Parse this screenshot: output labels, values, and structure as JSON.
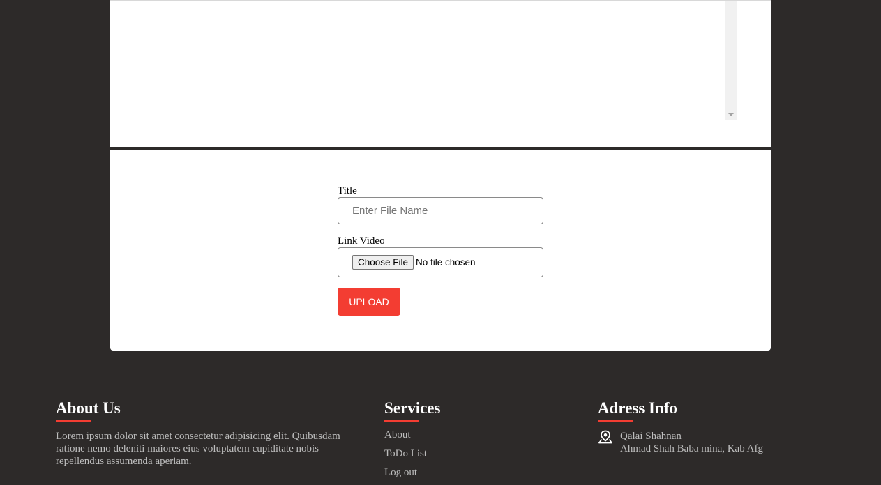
{
  "form": {
    "title_label": "Title",
    "title_placeholder": "Enter File Name",
    "video_label": "Link Video",
    "choose_file_label": "Choose File",
    "no_file_text": "No file chosen",
    "upload_label": "UPLOAD"
  },
  "footer": {
    "about": {
      "heading": "About Us",
      "text": "Lorem ipsum dolor sit amet consectetur adipisicing elit. Quibusdam ratione nemo deleniti maiores eius voluptatem cupiditate nobis repellendus assumenda aperiam."
    },
    "services": {
      "heading": "Services",
      "links": [
        "About",
        "ToDo List",
        "Log out"
      ]
    },
    "address": {
      "heading": "Adress Info",
      "line1": "Qalai Shahnan",
      "line2": "Ahmad Shah Baba mina, Kab Afg",
      "icon": "location-pin-icon"
    }
  },
  "colors": {
    "background": "#2d2a29",
    "accent": "#f33d32",
    "panel": "#ffffff"
  }
}
